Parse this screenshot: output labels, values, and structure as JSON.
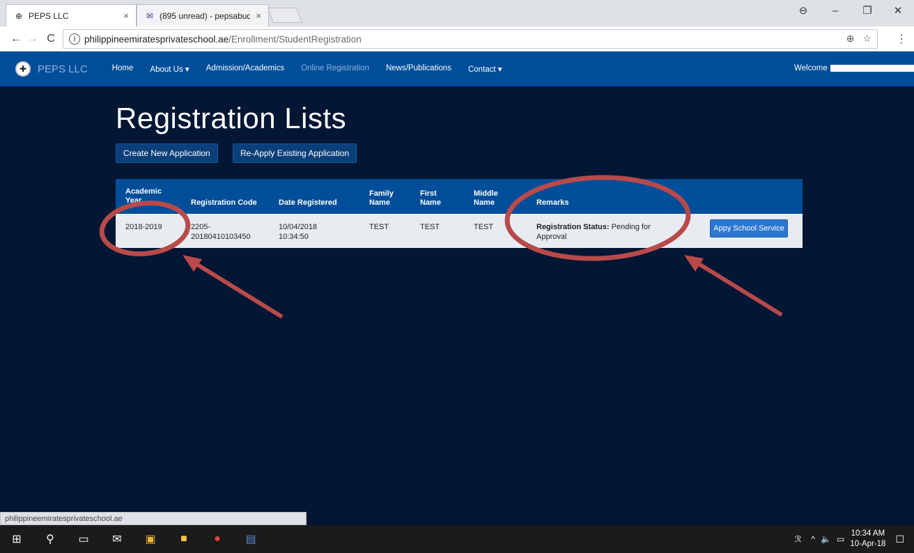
{
  "browser": {
    "tabs": [
      {
        "title": "PEPS LLC",
        "active": true
      },
      {
        "title": "(895 unread) - pepsabudì",
        "active": false
      }
    ],
    "tab_close": "×",
    "url_domain": "philippineemiratesprivateschool.ae",
    "url_path": "/Enrollment/StudentRegistration",
    "status_url": "philippineemiratesprivateschool.ae"
  },
  "site": {
    "brand": "PEPS LLC",
    "nav": [
      "Home",
      "About Us ▾",
      "Admission/Academics",
      "Online Registration",
      "News/Publications",
      "Contact ▾"
    ],
    "welcome": "Welcome"
  },
  "page": {
    "title": "Registration Lists",
    "buttons": {
      "create": "Create New Application",
      "reapply": "Re-Apply Existing Application"
    }
  },
  "table": {
    "headers": [
      "Academic Year",
      "Registration Code",
      "Date Registered",
      "Family Name",
      "First Name",
      "Middle Name",
      "Remarks"
    ],
    "row": {
      "academic_year": "2018-2019",
      "registration_code_1": "2205-",
      "registration_code_2": "20180410103450",
      "date_1": "10/04/2018",
      "date_2": "10:34:50",
      "family_name": "TEST",
      "first_name": "TEST",
      "middle_name": "TEST",
      "remarks_label": "Registration Status:",
      "remarks_value_1": " Pending for",
      "remarks_value_2": "Approval",
      "action": "Appy School Service"
    }
  },
  "taskbar": {
    "time": "10:34 AM",
    "date": "10-Apr-18"
  },
  "colors": {
    "navbar": "#004d99",
    "page_bg": "#031633",
    "annotation": "#b84a4a"
  }
}
